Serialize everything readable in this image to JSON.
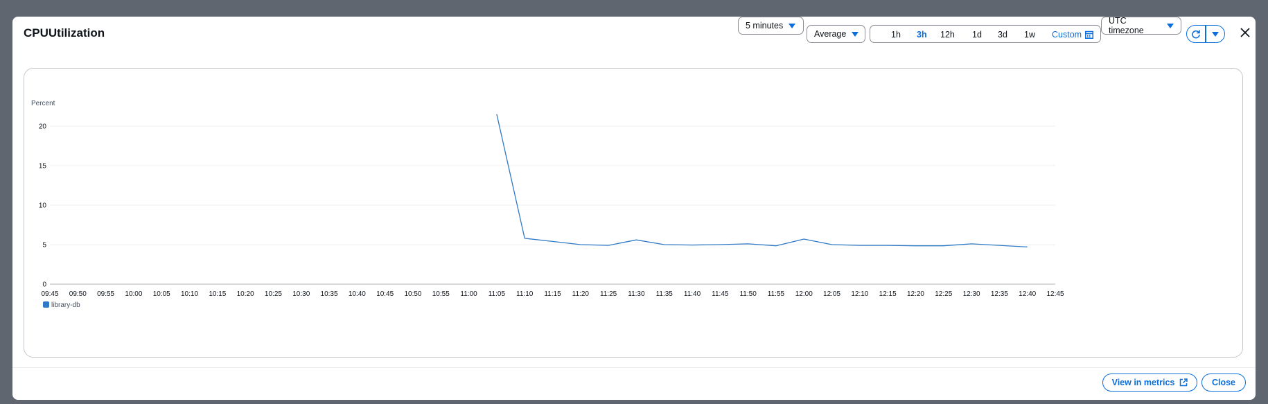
{
  "title": "CPUUtilization",
  "toolbar": {
    "period": "5 minutes",
    "statistic": "Average",
    "ranges": [
      "1h",
      "3h",
      "12h",
      "1d",
      "3d",
      "1w"
    ],
    "selected_range": "3h",
    "custom_label": "Custom",
    "timezone": "UTC timezone"
  },
  "footer": {
    "view_in_metrics": "View in metrics",
    "close": "Close"
  },
  "colors": {
    "accent": "#0a6edb",
    "series": "#2f79c5"
  },
  "chart_data": {
    "type": "line",
    "title": "",
    "ylabel": "Percent",
    "xlabel": "",
    "ylim": [
      0,
      20
    ],
    "yticks": [
      0,
      5,
      10,
      15,
      20
    ],
    "x_ticks": [
      "09:45",
      "09:50",
      "09:55",
      "10:00",
      "10:05",
      "10:10",
      "10:15",
      "10:20",
      "10:25",
      "10:30",
      "10:35",
      "10:40",
      "10:45",
      "10:50",
      "10:55",
      "11:00",
      "11:05",
      "11:10",
      "11:15",
      "11:20",
      "11:25",
      "11:30",
      "11:35",
      "11:40",
      "11:45",
      "11:50",
      "11:55",
      "12:00",
      "12:05",
      "12:10",
      "12:15",
      "12:20",
      "12:25",
      "12:30",
      "12:35",
      "12:40",
      "12:45"
    ],
    "grid": true,
    "legend_position": "bottom-left",
    "series": [
      {
        "name": "library-db",
        "x": [
          "11:05",
          "11:10",
          "11:15",
          "11:20",
          "11:25",
          "11:30",
          "11:35",
          "11:40",
          "11:45",
          "11:50",
          "11:55",
          "12:00",
          "12:05",
          "12:10",
          "12:15",
          "12:20",
          "12:25",
          "12:30",
          "12:35",
          "12:40"
        ],
        "values": [
          21.5,
          5.8,
          5.4,
          5.0,
          4.9,
          5.6,
          5.0,
          4.95,
          5.0,
          5.1,
          4.85,
          5.7,
          5.0,
          4.9,
          4.9,
          4.85,
          4.85,
          5.1,
          4.9,
          4.7
        ]
      }
    ]
  }
}
